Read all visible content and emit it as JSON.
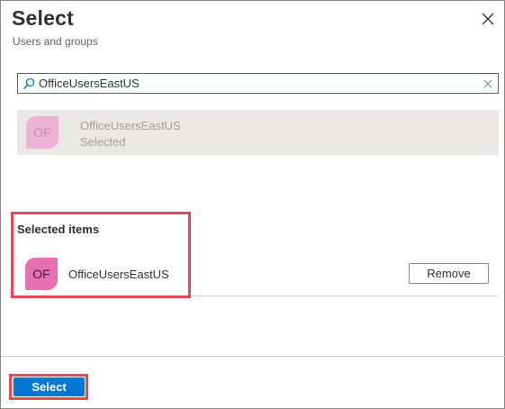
{
  "header": {
    "title": "Select",
    "subtitle": "Users and groups"
  },
  "search": {
    "value": "OfficeUsersEastUS"
  },
  "results": [
    {
      "initials": "OF",
      "name": "OfficeUsersEastUS",
      "status": "Selected"
    }
  ],
  "selected_items": {
    "heading": "Selected items",
    "items": [
      {
        "initials": "OF",
        "name": "OfficeUsersEastUS",
        "remove_label": "Remove"
      }
    ]
  },
  "footer": {
    "select_label": "Select"
  },
  "colors": {
    "accent": "#0078d4",
    "highlight": "#e74856",
    "avatar_dim": "#ebb2d6",
    "avatar": "#e770b4"
  },
  "icons": {
    "close": "close-icon",
    "search": "search-icon",
    "clear": "clear-icon"
  }
}
